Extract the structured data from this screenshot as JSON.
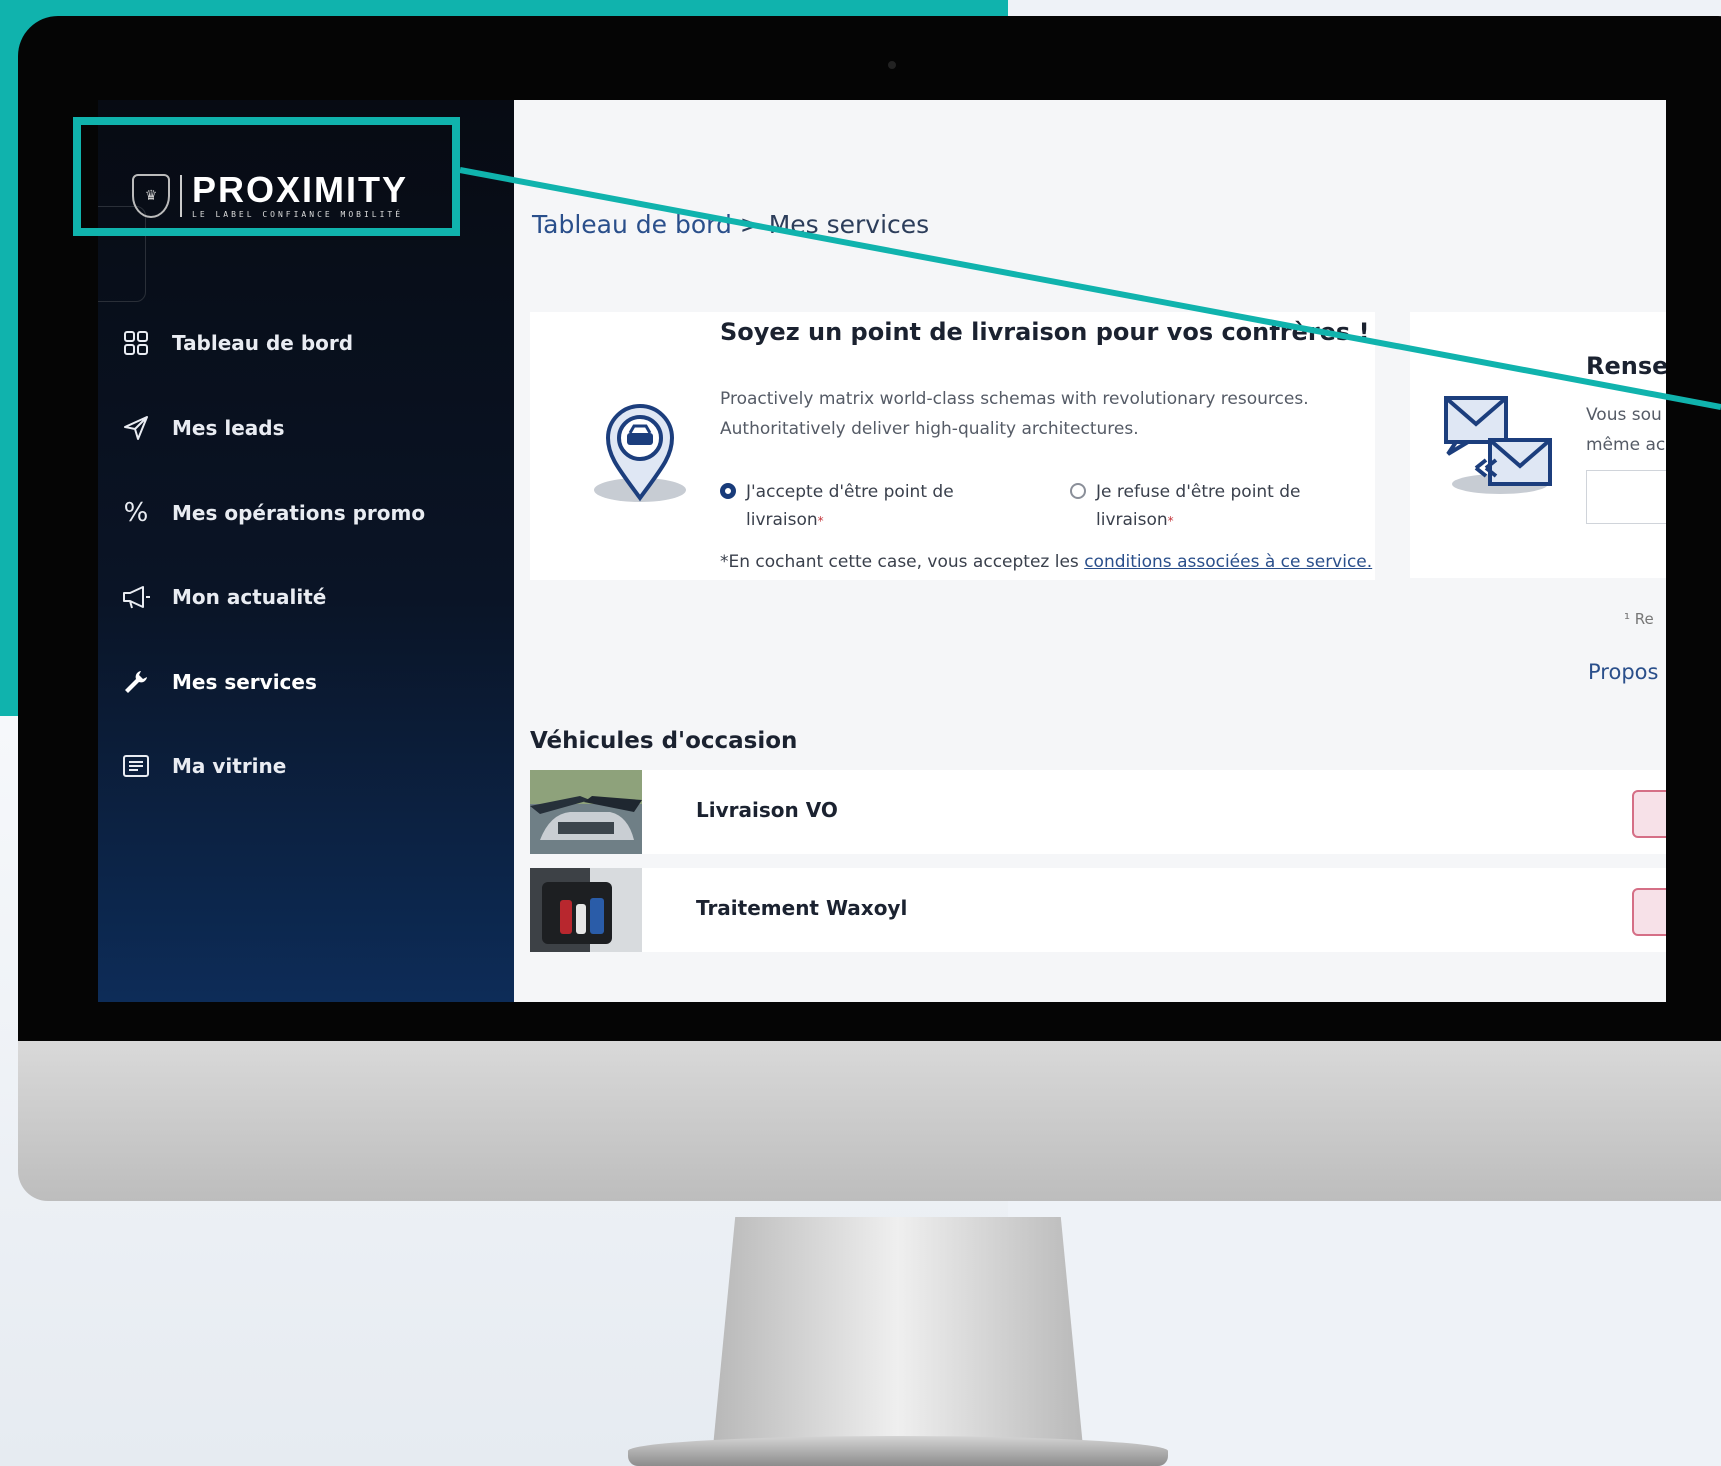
{
  "brand": {
    "title": "PROXIMITY",
    "subtitle": "LE LABEL CONFIANCE MOBILITÉ"
  },
  "sidebar": {
    "items": [
      {
        "label": "Tableau de bord",
        "icon": "grid-icon"
      },
      {
        "label": "Mes leads",
        "icon": "send-icon"
      },
      {
        "label": "Mes opérations promo",
        "icon": "percent-icon"
      },
      {
        "label": "Mon actualité",
        "icon": "megaphone-icon"
      },
      {
        "label": "Mes services",
        "icon": "wrench-icon",
        "active": true
      },
      {
        "label": "Ma vitrine",
        "icon": "document-icon"
      }
    ]
  },
  "breadcrumb": {
    "parent": "Tableau de bord",
    "separator": ">",
    "current": "Mes services"
  },
  "delivery_card": {
    "title": "Soyez un point de livraison pour vos confrères !",
    "description_line1": "Proactively matrix world-class schemas with revolutionary resources.",
    "description_line2": "Authoritatively deliver high-quality architectures.",
    "option_accept_line1": "J'accepte d'être point de",
    "option_accept_line2": "livraison",
    "option_refuse_line1": "Je refuse d'être point de",
    "option_refuse_line2": "livraison",
    "required_mark": "*",
    "legal_prefix": "*En cochant cette case, vous acceptez les ",
    "legal_link": "conditions associées à ce service."
  },
  "second_card": {
    "title": "Rense",
    "text_line1": "Vous sou",
    "text_line2": "même ac"
  },
  "footnote": "¹ Re",
  "propose_link": "Propos",
  "section": {
    "title": "Véhicules d'occasion",
    "rows": [
      {
        "label": "Livraison VO"
      },
      {
        "label": "Traitement Waxoyl"
      }
    ]
  },
  "colors": {
    "accent_teal": "#10b3ad",
    "sidebar_dark": "#070b13",
    "link_blue": "#2a4f8b",
    "button_pink": "#d56f86"
  }
}
